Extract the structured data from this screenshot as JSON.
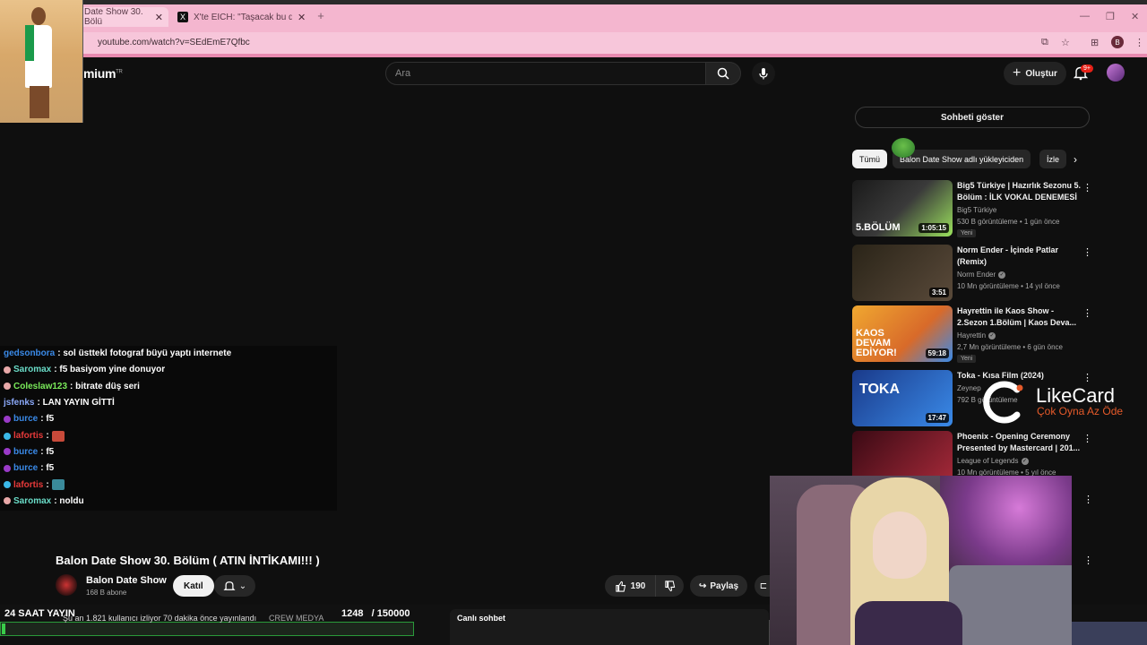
{
  "browser": {
    "tabs": [
      {
        "label": "Date Show 30. Bölü",
        "active": true
      },
      {
        "label": "X'te EICH: \"Taşacak bu deniz ü",
        "active": false
      }
    ],
    "url": "youtube.com/watch?v=SEdEmE7Qfbc",
    "profile_initial": "B"
  },
  "header": {
    "logo_text": "mium",
    "logo_sup": "TR",
    "search_placeholder": "Ara",
    "create_label": "Oluştur",
    "notification_count": "9+"
  },
  "chat_overlay": {
    "messages": [
      {
        "user": "gedsonbora",
        "text": ": sol üsttekl fotograf büyü yaptı internete",
        "color": "#3a8ae8",
        "badge": ""
      },
      {
        "user": "Saromax",
        "text": ": f5 basiyom yine donuyor",
        "color": "#6adcc8",
        "badge": "#e8a8a8"
      },
      {
        "user": "Coleslaw123",
        "text": ": bitrate düş seri",
        "color": "#7aea5a",
        "badge": "#e8a8a8"
      },
      {
        "user": "jsfenks",
        "text": ": LAN YAYIN GİTTİ",
        "color": "#8aa8f8",
        "badge": ""
      },
      {
        "user": "burce",
        "text": ": f5",
        "color": "#3a8ae8",
        "badge": "#9a3ac8"
      },
      {
        "user": "lafortis",
        "text": ":",
        "color": "#e83a3a",
        "badge": "#3ab8e8",
        "emote": true
      },
      {
        "user": "burce",
        "text": ": f5",
        "color": "#3a8ae8",
        "badge": "#9a3ac8"
      },
      {
        "user": "burce",
        "text": ": f5",
        "color": "#3a8ae8",
        "badge": "#9a3ac8"
      },
      {
        "user": "lafortis",
        "text": ":",
        "color": "#e83a3a",
        "badge": "#3ab8e8",
        "emote": true
      },
      {
        "user": "Saromax",
        "text": ": noldu",
        "color": "#6adcc8",
        "badge": "#e8a8a8"
      }
    ]
  },
  "video": {
    "title": "Balon Date Show 30. Bölüm ( ATIN İNTİKAMI!!! )",
    "channel_name": "Balon Date Show",
    "subscribers": "168 B abone",
    "join_label": "Katıl",
    "like_count": "190",
    "share_label": "Paylaş"
  },
  "stream_overlay": {
    "label": "24 SAAT YAYIN",
    "viewers_text": "Şu an 1.821 kullanıcı izliyor  70 dakika önce yayınlandı",
    "crew_text": "CREW MEDYA",
    "goal_current": "1248",
    "goal_total": "/ 150000",
    "goal_fraction": 0.0083,
    "live_chat_label": "Canlı sohbet"
  },
  "sidebar": {
    "show_chat_label": "Sohbeti göster",
    "chips": [
      "Tümü",
      "Balon Date Show adlı yükleyiciden",
      "İzle"
    ],
    "recommendations": [
      {
        "title": "Big5 Türkiye | Hazırlık Sezonu 5. Bölüm : İLK VOKAL DENEMESİ",
        "channel": "Big5 Türkiye",
        "meta": "530 B görüntüleme • 1 gün önce",
        "badge": "Yeni",
        "duration": "1:05:15",
        "thumb_text": "5.BÖLÜM",
        "verified": false
      },
      {
        "title": "Norm Ender - İçinde Patlar (Remix)",
        "channel": "Norm Ender",
        "meta": "10 Mn görüntüleme • 14 yıl önce",
        "badge": "",
        "duration": "3:51",
        "thumb_text": "",
        "verified": true
      },
      {
        "title": "Hayrettin ile Kaos Show - 2.Sezon 1.Bölüm | Kaos Deva...",
        "channel": "Hayrettin",
        "meta": "2,7 Mn görüntüleme • 6 gün önce",
        "badge": "Yeni",
        "duration": "59:18",
        "thumb_text": "KAOS DEVAM EDİYOR!",
        "verified": true
      },
      {
        "title": "Toka - Kısa Film (2024)",
        "channel": "Zeynep",
        "meta": "792 B görüntüleme",
        "badge": "",
        "duration": "17:47",
        "thumb_text": "TOKA",
        "verified": false
      },
      {
        "title": "Phoenix - Opening Ceremony Presented by Mastercard | 201...",
        "channel": "League of Legends",
        "meta": "10 Mn görüntüleme • 5 yıl önce",
        "badge": "",
        "duration": "",
        "thumb_text": "",
        "verified": true
      }
    ]
  },
  "watermark": {
    "name": "LikeCard",
    "slogan": "Çok Oyna  Az Öde"
  },
  "colors": {
    "tabbar": "#f4b6cf",
    "yt_bg": "#0f0f0f",
    "accent_red": "#e62117",
    "goal_green": "#3acc4a",
    "likecard_orange": "#e55a2a"
  }
}
